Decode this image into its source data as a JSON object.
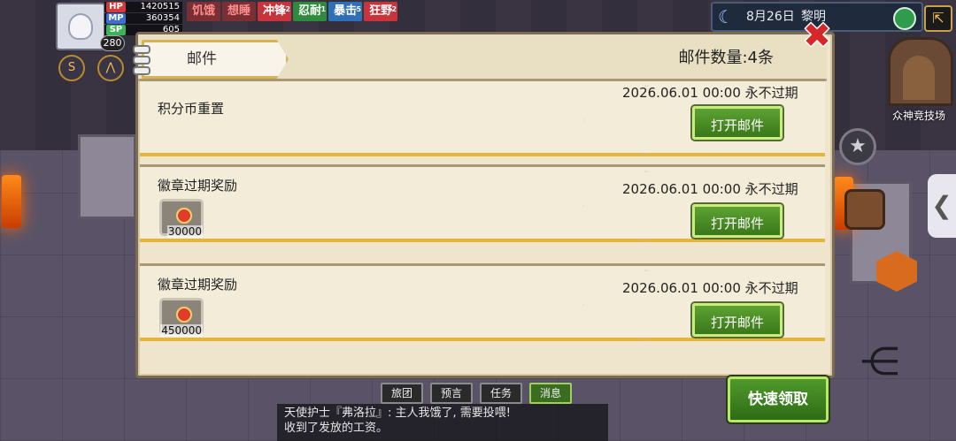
{
  "hud": {
    "level": "280",
    "stats": [
      {
        "label": "HP",
        "value": "1420515"
      },
      {
        "label": "MP",
        "value": "360354"
      },
      {
        "label": "SP",
        "value": "605"
      }
    ],
    "buffs": [
      {
        "label": "饥饿",
        "count": "",
        "style": "b-dim"
      },
      {
        "label": "想睡",
        "count": "",
        "style": "b-dim"
      },
      {
        "label": "冲锋",
        "count": "2",
        "style": "b-red"
      },
      {
        "label": "忍耐",
        "count": "1",
        "style": "b-green"
      },
      {
        "label": "暴击",
        "count": "5",
        "style": "b-blue"
      },
      {
        "label": "狂野",
        "count": "2",
        "style": "b-red"
      }
    ]
  },
  "topbar": {
    "date": "8月26日",
    "period": "黎明"
  },
  "side": {
    "arena_label": "众神竞技场"
  },
  "mail": {
    "title": "邮件",
    "count_label": "邮件数量:4条",
    "items": [
      {
        "title": "积分币重置",
        "date": "2026.06.01 00:00  永不过期",
        "button": "打开邮件",
        "has_item": false,
        "qty": ""
      },
      {
        "title": "徽章过期奖励",
        "date": "2026.06.01 00:00  永不过期",
        "button": "打开邮件",
        "has_item": true,
        "qty": "30000"
      },
      {
        "title": "徽章过期奖励",
        "date": "2026.06.01 00:00  永不过期",
        "button": "打开邮件",
        "has_item": true,
        "qty": "450000"
      }
    ]
  },
  "quick_collect": "快速领取",
  "chat": {
    "tabs": [
      "旅团",
      "预言",
      "任务",
      "消息"
    ],
    "active_tab": "消息",
    "lines": [
      "天使护士『弗洛拉』: 主人我饿了, 需要投喂!",
      "收到了发放的工资。"
    ]
  }
}
